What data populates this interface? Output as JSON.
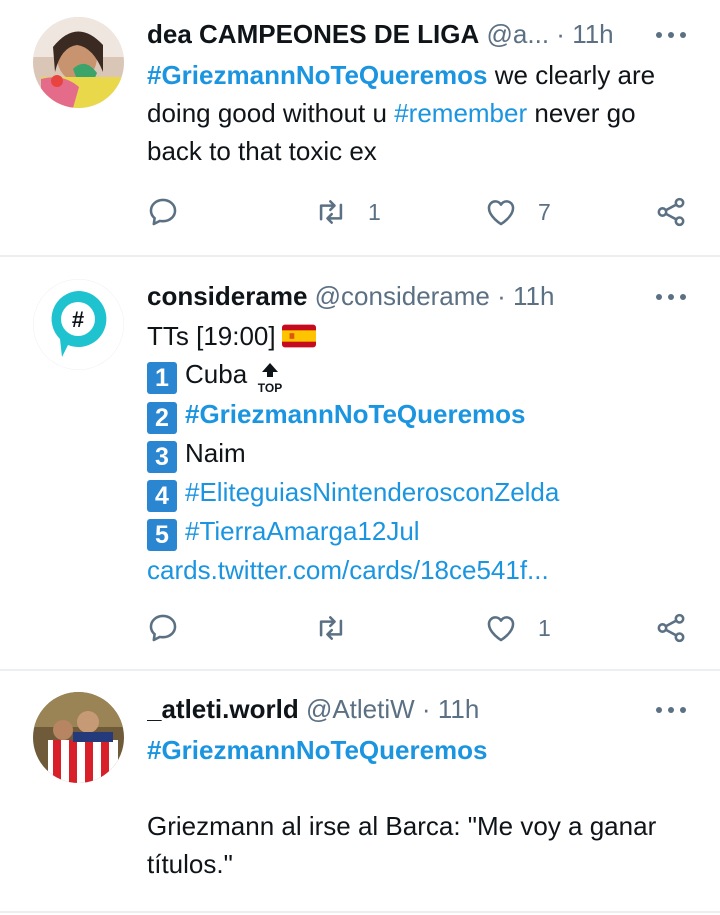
{
  "tweets": [
    {
      "name": "dea CAMPEONES DE LIGA",
      "handle": "@a...",
      "dot": "·",
      "time": "11h",
      "text_parts": {
        "hashtag1": "#GriezmannNoTeQueremos",
        "text1": " we clearly are doing good without u ",
        "hashtag2": "#remember",
        "text2": " never go back to that toxic ex"
      },
      "retweets": "1",
      "likes": "7"
    },
    {
      "name": "considerame",
      "handle": "@considerame",
      "dot": "·",
      "time": "11h",
      "avatar_symbol": "#",
      "title": "TTs [19:00]",
      "top_badge": "TOP",
      "trends": [
        {
          "num": "1",
          "label": "Cuba"
        },
        {
          "num": "2",
          "label": "#GriezmannNoTeQueremos"
        },
        {
          "num": "3",
          "label": "Naim"
        },
        {
          "num": "4",
          "label": "#EliteguiasNintenderosconZelda"
        },
        {
          "num": "5",
          "label": "#TierraAmarga12Jul"
        }
      ],
      "link": "cards.twitter.com/cards/18ce541f...",
      "likes": "1"
    },
    {
      "name": "_atleti.world",
      "handle": "@AtletiW",
      "dot": "·",
      "time": "11h",
      "hashtag": "#GriezmannNoTeQueremos",
      "text": "Griezmann al irse al Barca: \"Me voy a ganar títulos.\""
    }
  ],
  "colors": {
    "link": "#1b95e0",
    "secondary_text": "#5b7083",
    "number_badge": "#2b86d2"
  }
}
